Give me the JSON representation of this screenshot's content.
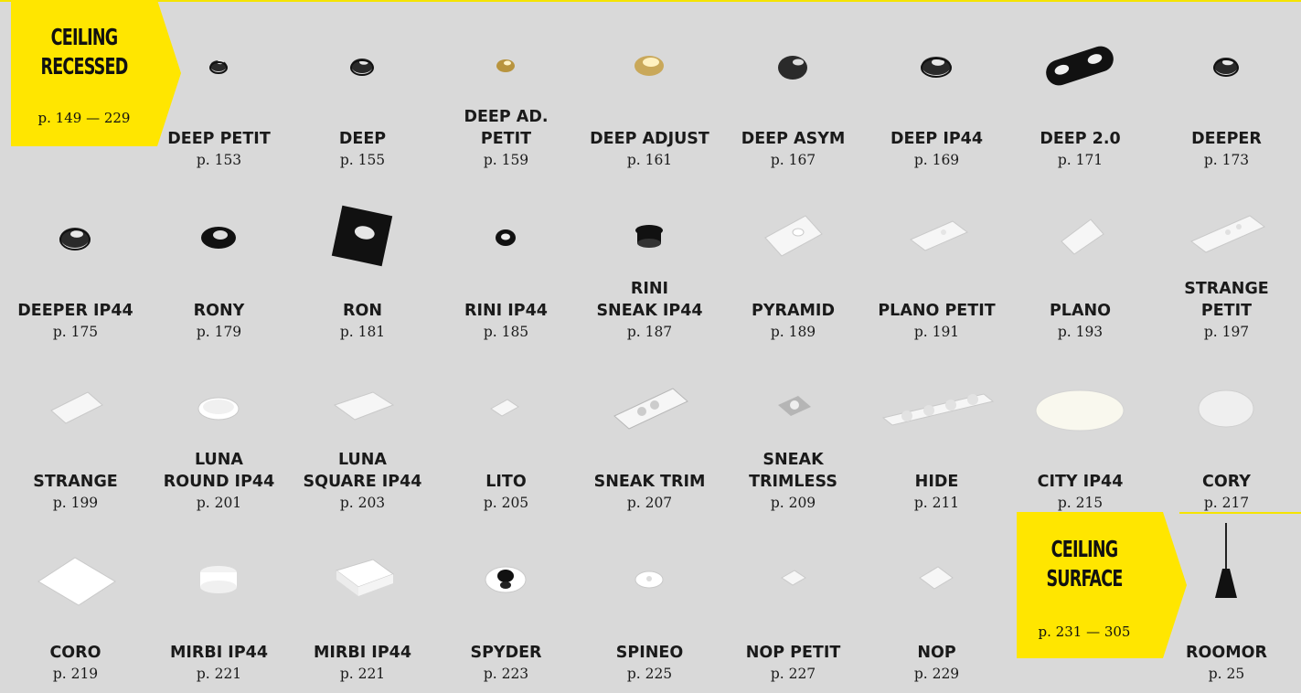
{
  "sections": {
    "recessed": {
      "title_line1": "CEILING",
      "title_line2": "RECESSED",
      "pages": "p. 149 — 229"
    },
    "surface": {
      "title_line1": "CEILING",
      "title_line2": "SURFACE",
      "pages": "p. 231 — 305"
    }
  },
  "products": [
    {
      "name": "DEEP PETIT",
      "page": "p. 153",
      "icon": "deep-petit-icon"
    },
    {
      "name": "DEEP",
      "page": "p. 155",
      "icon": "deep-icon"
    },
    {
      "name": "DEEP AD.\nPETIT",
      "page": "p. 159",
      "icon": "deep-ad-petit-icon"
    },
    {
      "name": "DEEP ADJUST",
      "page": "p. 161",
      "icon": "deep-adjust-icon"
    },
    {
      "name": "DEEP ASYM",
      "page": "p. 167",
      "icon": "deep-asym-icon"
    },
    {
      "name": "DEEP IP44",
      "page": "p. 169",
      "icon": "deep-ip44-icon"
    },
    {
      "name": "DEEP 2.0",
      "page": "p. 171",
      "icon": "deep-2-icon"
    },
    {
      "name": "DEEPER",
      "page": "p. 173",
      "icon": "deeper-icon"
    },
    {
      "name": "DEEPER IP44",
      "page": "p. 175",
      "icon": "deeper-ip44-icon"
    },
    {
      "name": "RONY",
      "page": "p. 179",
      "icon": "rony-icon"
    },
    {
      "name": "RON",
      "page": "p. 181",
      "icon": "ron-icon"
    },
    {
      "name": "RINI IP44",
      "page": "p. 185",
      "icon": "rini-ip44-icon"
    },
    {
      "name": "RINI\nSNEAK IP44",
      "page": "p. 187",
      "icon": "rini-sneak-ip44-icon"
    },
    {
      "name": "PYRAMID",
      "page": "p. 189",
      "icon": "pyramid-icon"
    },
    {
      "name": "PLANO PETIT",
      "page": "p. 191",
      "icon": "plano-petit-icon"
    },
    {
      "name": "PLANO",
      "page": "p. 193",
      "icon": "plano-icon"
    },
    {
      "name": "STRANGE\nPETIT",
      "page": "p. 197",
      "icon": "strange-petit-icon"
    },
    {
      "name": "STRANGE",
      "page": "p. 199",
      "icon": "strange-icon"
    },
    {
      "name": "LUNA\nROUND IP44",
      "page": "p. 201",
      "icon": "luna-round-icon"
    },
    {
      "name": "LUNA\nSQUARE IP44",
      "page": "p. 203",
      "icon": "luna-square-icon"
    },
    {
      "name": "LITO",
      "page": "p. 205",
      "icon": "lito-icon"
    },
    {
      "name": "SNEAK TRIM",
      "page": "p. 207",
      "icon": "sneak-trim-icon"
    },
    {
      "name": "SNEAK\nTRIMLESS",
      "page": "p. 209",
      "icon": "sneak-trimless-icon"
    },
    {
      "name": "HIDE",
      "page": "p. 211",
      "icon": "hide-icon"
    },
    {
      "name": "CITY IP44",
      "page": "p. 215",
      "icon": "city-ip44-icon"
    },
    {
      "name": "CORY",
      "page": "p. 217",
      "icon": "cory-icon"
    },
    {
      "name": "CORO",
      "page": "p. 219",
      "icon": "coro-icon"
    },
    {
      "name": "MIRBI IP44",
      "page": "p. 221",
      "icon": "mirbi-ip44-round-icon"
    },
    {
      "name": "MIRBI IP44",
      "page": "p. 221",
      "icon": "mirbi-ip44-square-icon"
    },
    {
      "name": "SPYDER",
      "page": "p. 223",
      "icon": "spyder-icon"
    },
    {
      "name": "SPINEO",
      "page": "p. 225",
      "icon": "spineo-icon"
    },
    {
      "name": "NOP PETIT",
      "page": "p. 227",
      "icon": "nop-petit-icon"
    },
    {
      "name": "NOP",
      "page": "p. 229",
      "icon": "nop-icon"
    },
    {
      "name": "ROOMOR",
      "page": "p. 25",
      "icon": "roomor-pendant-icon"
    }
  ],
  "colors": {
    "background": "#d9d9d9",
    "accent_yellow": "#ffe600",
    "text": "#1a1a1a"
  }
}
